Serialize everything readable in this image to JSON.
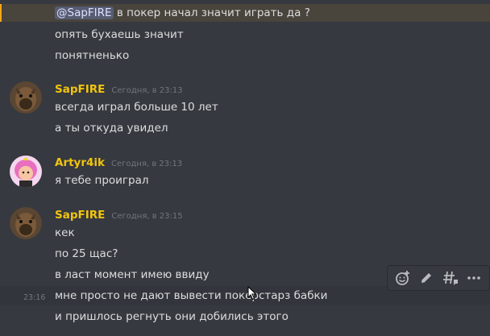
{
  "messages": {
    "mention_line": {
      "mention": "@SapFIRE",
      "text": " в покер начал значит играть да ?"
    },
    "line_2": "опять бухаешь  значит",
    "line_3": "понятненько",
    "group_1": {
      "username": "SapFIRE",
      "user_color": "#f1c40f",
      "timestamp": "Сегодня, в 23:13",
      "lines": [
        "всегда играл больше 10 лет",
        "а ты откуда увидел"
      ]
    },
    "group_2": {
      "username": "Artyr4ik",
      "user_color": "#f1c40f",
      "timestamp": "Сегодня, в 23:13",
      "lines": [
        "я тебе  проиграл"
      ]
    },
    "group_3": {
      "username": "SapFIRE",
      "user_color": "#f1c40f",
      "timestamp": "Сегодня, в 23:15",
      "lines": [
        "кек",
        "по 25 щас?",
        "в ласт момент имею ввиду",
        "мне просто не дают вывести покерстарз бабки",
        "и пришлось регнуть они добились этого"
      ],
      "hover_timestamp": "23:16"
    }
  },
  "toolbar": {
    "icons": [
      "add-reaction-icon",
      "edit-icon",
      "create-thread-icon",
      "more-icon"
    ]
  },
  "colors": {
    "background": "#36393f",
    "mention_highlight": "#49443c",
    "mention_bar": "#faa61a",
    "username": "#f1c40f"
  }
}
